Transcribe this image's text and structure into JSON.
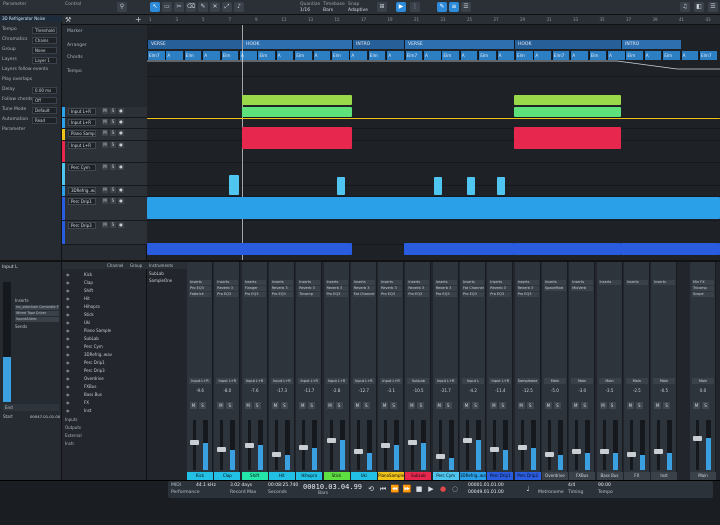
{
  "toolbar": {
    "parameter": "Parameter",
    "control": "Control",
    "quantize_label": "Quantize",
    "timebase_label": "Timebase",
    "snap_label": "Snap",
    "quantize": "1/16",
    "timebase": "Bars",
    "snap": "Adaptive"
  },
  "inspector": {
    "title": "3D Refrigerator Noise",
    "rows": [
      {
        "k": "Tempo",
        "v": "Threshold"
      },
      {
        "k": "Chromatics",
        "v": "Chains"
      },
      {
        "k": "Group",
        "v": "None"
      },
      {
        "k": "Layers",
        "v": "Layer 1"
      },
      {
        "k": "Layers follow events",
        "v": ""
      },
      {
        "k": "Play overlaps",
        "v": ""
      },
      {
        "k": "Delay",
        "v": "0.00 ms"
      },
      {
        "k": "Follow chords",
        "v": "Off"
      },
      {
        "k": "Tune Mode",
        "v": "Default"
      },
      {
        "k": "Automation",
        "v": "Read"
      },
      {
        "k": "Parameter",
        "v": ""
      }
    ]
  },
  "tracks": [
    {
      "name": "Input L+R",
      "color": "#2aa0e8"
    },
    {
      "name": "Input L+R",
      "color": "#2aa0e8"
    },
    {
      "name": "Piano Sample",
      "color": "#f0c419"
    },
    {
      "name": "Input L+R",
      "color": "#e8274f"
    },
    {
      "name": "Perc Cym",
      "color": "#4fc6f0"
    },
    {
      "name": "3DRefrig..wav",
      "color": "#2aa0e8"
    },
    {
      "name": "Perc Drip1",
      "color": "#2a5ce0"
    },
    {
      "name": "Perc Drip3",
      "color": "#2a5ce0"
    }
  ],
  "ruler": {
    "ticks": [
      "1",
      "3",
      "5",
      "7",
      "9",
      "11",
      "13",
      "15",
      "17",
      "19",
      "21",
      "23",
      "25",
      "27",
      "29",
      "31",
      "33",
      "35",
      "37",
      "39",
      "41",
      "43"
    ]
  },
  "sections": [
    {
      "label": "VERSE",
      "start": 0,
      "w": 95
    },
    {
      "label": "HOOK",
      "start": 95,
      "w": 110
    },
    {
      "label": "INTRO",
      "start": 205,
      "w": 52
    },
    {
      "label": "VERSE",
      "start": 257,
      "w": 110
    },
    {
      "label": "HOOK",
      "start": 367,
      "w": 107
    },
    {
      "label": "INTRO",
      "start": 474,
      "w": 60
    }
  ],
  "chords": [
    "Elm7",
    "A",
    "Elm",
    "A",
    "Elm",
    "A",
    "Elm",
    "A",
    "Elm",
    "A",
    "Elm",
    "A",
    "Elm",
    "A",
    "Elm7",
    "A",
    "Elm",
    "A",
    "Elm",
    "A",
    "Elm",
    "A",
    "Elm7",
    "A",
    "Elm",
    "A",
    "Elm",
    "A",
    "Elm",
    "A",
    "Elm7"
  ],
  "mixer": {
    "channels": [
      {
        "name": "Kick",
        "input": "Input L+R",
        "vol": "-9.6",
        "color": "#23c0e6",
        "level": 0.55,
        "fx": [
          "Inserts",
          "Pro EQ3",
          "Fatbrick"
        ]
      },
      {
        "name": "Clap",
        "input": "Input L+R",
        "vol": "-8.0",
        "color": "#23c0e6",
        "level": 0.4,
        "fx": [
          "Inserts",
          "Reverb 3",
          "Pro EQ3"
        ]
      },
      {
        "name": "Shift",
        "input": "Input L+R",
        "vol": "-7.6",
        "color": "#23e6a8",
        "level": 0.5,
        "fx": [
          "Inserts",
          "Flanger",
          "Pro EQ3"
        ]
      },
      {
        "name": "Hit",
        "input": "Input L+R",
        "vol": "-17.3",
        "color": "#23c0e6",
        "level": 0.3,
        "fx": [
          "Inserts",
          "Reverb 3",
          "Pro EQ3"
        ]
      },
      {
        "name": "Hihopra",
        "input": "Input L+R",
        "vol": "-11.7",
        "color": "#23c0e6",
        "level": 0.45,
        "fx": [
          "Inserts",
          "Reverb 3",
          "Tricomp"
        ]
      },
      {
        "name": "Stick",
        "input": "Input L+R",
        "vol": "-2.8",
        "color": "#5ee043",
        "level": 0.6,
        "fx": [
          "Inserts",
          "Reverb 3",
          "Pro EQ3"
        ]
      },
      {
        "name": "Uki",
        "input": "Input L+R",
        "vol": "-12.7",
        "color": "#23c0e6",
        "level": 0.35,
        "fx": [
          "Inserts",
          "Reverb 3",
          "Fat Channel"
        ]
      },
      {
        "name": "PianoSample",
        "input": "Input L+R",
        "vol": "-3.1",
        "color": "#f0c419",
        "level": 0.5,
        "fx": [
          "Inserts",
          "Reverb 3",
          "Pro EQ3"
        ]
      },
      {
        "name": "SubLab",
        "input": "SubLab",
        "vol": "-10.5",
        "color": "#e8274f",
        "level": 0.55,
        "fx": [
          "Inserts",
          "Reverb 3",
          "Pro EQ3"
        ]
      },
      {
        "name": "Perc Cym",
        "input": "Input L+R",
        "vol": "-21.7",
        "color": "#4fc6f0",
        "level": 0.25,
        "fx": [
          "Inserts",
          "Reverb 3",
          "Pro EQ3"
        ]
      },
      {
        "name": "3DRefrig..wav",
        "input": "Input L",
        "vol": "-4.2",
        "color": "#2aa0e8",
        "level": 0.6,
        "fx": [
          "Inserts",
          "Fat Channel",
          "Pro EQ3"
        ]
      },
      {
        "name": "Perc Drip1",
        "input": "Input L+R",
        "vol": "-11.4",
        "color": "#2a5ce0",
        "level": 0.4,
        "fx": [
          "Inserts",
          "Reverb 3",
          "Pro EQ3"
        ]
      },
      {
        "name": "Perc Drip3",
        "input": "Sampleone",
        "vol": "-12.5",
        "color": "#2a5ce0",
        "level": 0.45,
        "fx": [
          "Inserts",
          "Reverb 3",
          "Pro EQ3"
        ]
      },
      {
        "name": "Overdrive",
        "input": "Main",
        "vol": "-5.0",
        "color": "#3a4149",
        "level": 0.3,
        "fx": [
          "Inserts",
          "SpaceMod"
        ]
      },
      {
        "name": "FXBus",
        "input": "Main",
        "vol": "-3.0",
        "color": "#3a4149",
        "level": 0.35,
        "fx": [
          "Inserts",
          "MixVerb"
        ]
      },
      {
        "name": "Bass Bus",
        "input": "Main",
        "vol": "-3.5",
        "color": "#3a4149",
        "level": 0.35,
        "fx": [
          "Inserts"
        ]
      },
      {
        "name": "FX",
        "input": "Main",
        "vol": "-2.5",
        "color": "#3a4149",
        "level": 0.3,
        "fx": [
          "Inserts"
        ]
      },
      {
        "name": "Inst",
        "input": "Main",
        "vol": "-0.5",
        "color": "#3a4149",
        "level": 0.35,
        "fx": [
          "Inserts"
        ]
      },
      {
        "name": "Main",
        "input": "Main",
        "vol": "0.0",
        "color": "#3a4149",
        "level": 0.65,
        "fx": [
          "Mix FX",
          "Tricomp",
          "Scope"
        ]
      }
    ]
  },
  "browser": {
    "tabs": [
      "Channel",
      "Group",
      "Instruments"
    ],
    "items": [
      "Kick",
      "Clap",
      "Shift",
      "Hit",
      "Hihopra",
      "Stick",
      "Uki",
      "Piano Sample",
      "SubLab",
      "Perc Cym",
      "3DRefrig..wav",
      "Perc Drip1",
      "Perc Drip3",
      "Overdrive",
      "FXBus",
      "Bass Bus",
      "FX",
      "Inst"
    ],
    "instruments": [
      "SubLab",
      "SampleOne"
    ],
    "sections": [
      "Inputs",
      "Outputs",
      "External",
      "Instr."
    ]
  },
  "leftmix": {
    "title": "Input L",
    "labels": [
      "Inserts",
      "Sends"
    ],
    "plugins": [
      "Ins_sidechain Cornorate FX",
      "Wheel Tape Driver",
      "Sound&Verb"
    ],
    "start": "Start",
    "end": "End",
    "start_val": "00001.01.01.00",
    "end_val": "00047.01.01.00"
  },
  "transport": {
    "rate": "44.1 kHz",
    "latency": "3.02 days",
    "time": "00:08:25.740",
    "bars": "00010.03.04.99",
    "loop_start": "00001.01.01.00",
    "loop_end": "00049.01.01.00",
    "sig": "4/4",
    "tempo": "90.00",
    "midi": "MIDI",
    "perf": "Performance",
    "mem": "Record Max",
    "sec": "Seconds",
    "bars_lbl": "Bars",
    "metro": "Metronome",
    "timing": "Timing",
    "tempo_lbl": "Tempo"
  }
}
